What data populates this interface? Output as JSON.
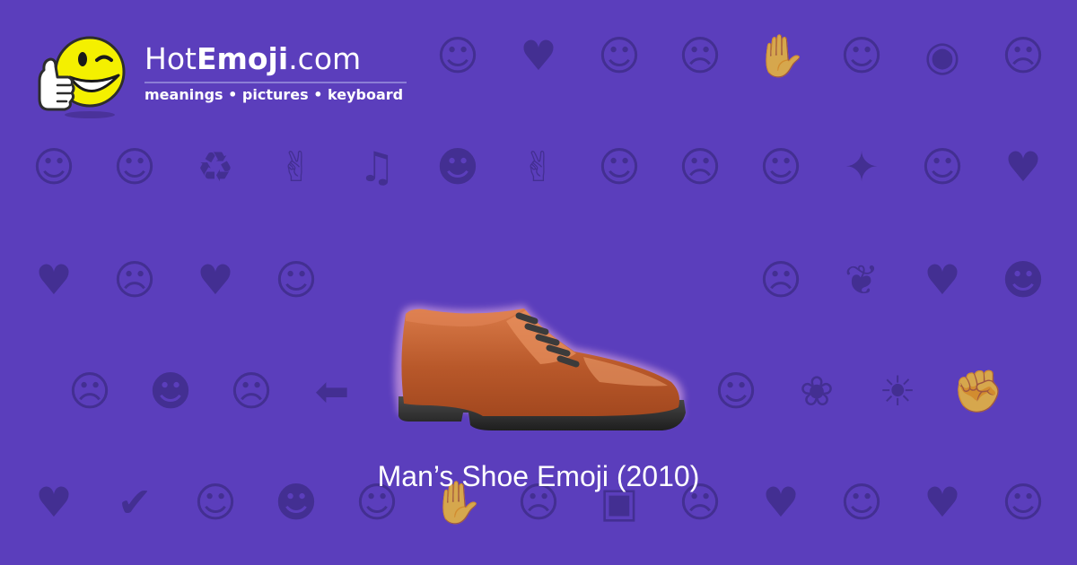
{
  "site": {
    "name_regular_prefix": "Hot",
    "name_bold": "Emoji",
    "name_regular_suffix": ".com",
    "tagline": "meanings • pictures • keyboard"
  },
  "hero": {
    "emoji_icon": "mans-shoe-icon",
    "caption": "Man’s Shoe Emoji (2010)"
  },
  "colors": {
    "background": "#5b3ebc",
    "pattern": "#3c2a84",
    "text": "#ffffff",
    "shoe_leather": "#c1602e",
    "shoe_sole": "#2b2b2b",
    "mascot_face": "#f4f000"
  },
  "background_pattern": [
    [
      "heart-icon",
      "grinning-face-icon",
      "face-icon",
      "face-icon",
      "face-icon",
      "winking-kiss-icon",
      "two-hearts-icon",
      "smiling-face-icon",
      "weary-face-icon",
      "ok-hand-icon",
      "neutral-face-icon",
      "eyes-icon",
      "unamused-face-icon"
    ],
    [
      "relieved-face-icon",
      "grimacing-face-icon",
      "recycle-icon",
      "raising-hands-icon",
      "music-notes-icon",
      "see-no-evil-monkey-icon",
      "victory-hand-icon",
      "sleeping-face-icon",
      "pensive-face-icon",
      "grinning-face-icon",
      "sparkles-icon",
      "grinning-face-icon",
      "striped-heart-icon"
    ],
    [
      "broken-heart-icon",
      "confused-face-icon",
      "striped-heart-icon",
      "winking-tongue-face-icon",
      "frowning-face-icon",
      "yum-face-icon",
      "neutral-face-icon",
      "raised-hand-icon",
      "heart-arrow-icon",
      "anguished-face-icon",
      "revolving-hearts-icon",
      "heart-icon",
      "monkey-icon"
    ],
    [
      "screaming-face-icon",
      "smiling-imp-icon",
      "angry-face-icon",
      "left-arrow-icon",
      "fire-icon",
      "sunglasses-face-icon",
      "relieved-face-icon",
      "bouquet-icon",
      "squinting-tongue-face-icon",
      "rose-icon",
      "sun-icon",
      "flexed-biceps-icon"
    ],
    [
      "striped-heart-icon",
      "check-mark-icon",
      "squinting-face-icon",
      "sun-face-icon",
      "cat-heart-eyes-icon",
      "waving-hand-icon",
      "mask-face-icon",
      "camera-icon",
      "tired-face-icon",
      "striped-heart-icon",
      "grinning-face-icon",
      "beating-heart-icon",
      "kissing-face-icon",
      "face-icon"
    ]
  ]
}
